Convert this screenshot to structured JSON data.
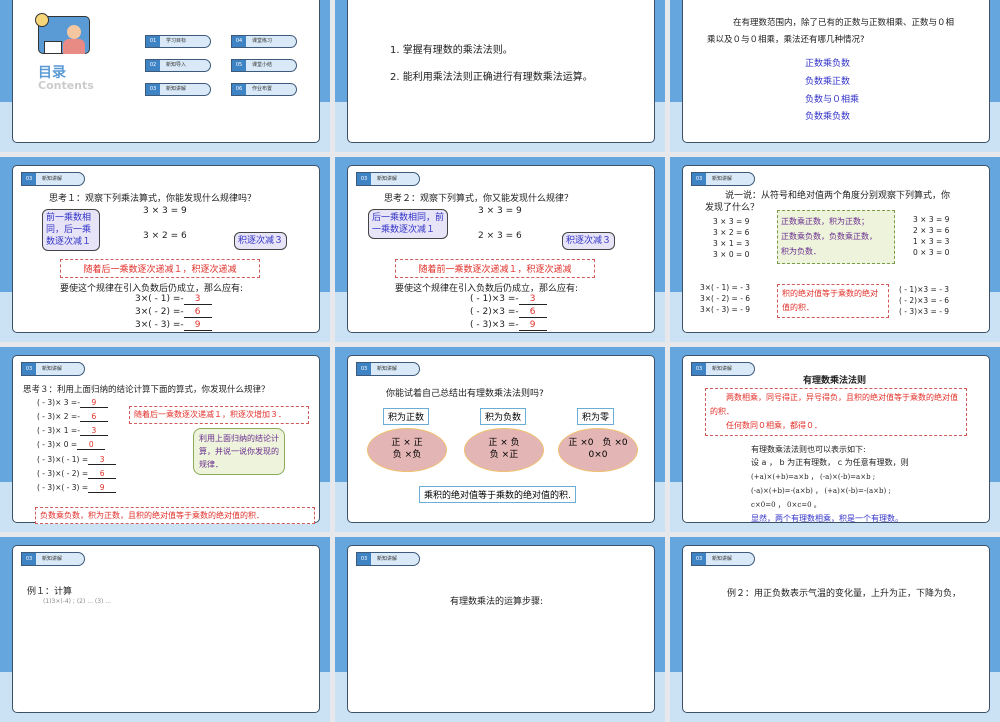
{
  "tag": {
    "num": "03",
    "label": "新知讲解"
  },
  "s1": {
    "title": "目录",
    "subtitle": "Contents",
    "items": [
      {
        "num": "01",
        "label": "学习目标"
      },
      {
        "num": "02",
        "label": "新知导入"
      },
      {
        "num": "03",
        "label": "新知讲解"
      },
      {
        "num": "04",
        "label": "课堂练习"
      },
      {
        "num": "05",
        "label": "课堂小结"
      },
      {
        "num": "06",
        "label": "作业布置"
      }
    ]
  },
  "s2": {
    "lines": [
      "1. 掌握有理数的乘法法则。",
      "2. 能利用乘法法则正确进行有理数乘法运算。"
    ]
  },
  "s3": {
    "intro": "在有理数范围内，除了已有的正数与正数相乘、正数与０相",
    "intro2": "乘以及０与０相乘，乘法还有哪几种情况?",
    "items": [
      "正数乘负数",
      "负数乘正数",
      "负数与０相乘",
      "负数乘负数"
    ]
  },
  "s4": {
    "q": "思考１：观察下列乘法算式，你能发现什么规律吗？",
    "eq": [
      "3 × 3  =  9",
      "3 × 2  =  6"
    ],
    "bubble": "前一乘数相同，后一乘数逐次减１",
    "bubble2": "积逐次减３",
    "note": "随着后一乘数逐次递减１，积逐次递减",
    "cond": "要使这个规律在引入负数后仍成立，那么应有:",
    "rows": [
      {
        "e": "3×( - 1) =-",
        "a": "3"
      },
      {
        "e": "3×( - 2) =-",
        "a": "6"
      },
      {
        "e": "3×( - 3) =-",
        "a": "9"
      }
    ]
  },
  "s5": {
    "q": "思考２：观察下列算式，你又能发现什么规律？",
    "eq": [
      "3 × 3  =  9",
      "2 × 3  =  6"
    ],
    "bubble": "后一乘数相同，前一乘数逐次减１",
    "bubble2": "积逐次减３",
    "note": "随着前一乘数逐次递减１，积逐次递减",
    "cond": "要使这个规律在引入负数后仍成立，那么应有:",
    "rows": [
      {
        "e": "( - 1)×3 =-",
        "a": "3"
      },
      {
        "e": "( - 2)×3 =-",
        "a": "6"
      },
      {
        "e": "( - 3)×3 =-",
        "a": "9"
      }
    ]
  },
  "s6": {
    "q": "说一说：从符号和绝对值两个角度分别观察下列算式，你",
    "q2": "发现了什么？",
    "left": [
      "3 × 3  =  9",
      "3 × 2  =  6",
      "3 × 1  =  3",
      "3 × 0  =  0"
    ],
    "right": [
      "3 × 3  =  9",
      "2 × 3  =  6",
      "1 × 3  =  3",
      "0 × 3  =  0"
    ],
    "green": [
      "正数乘正数，积为正数；",
      "正数乘负数，负数乘正数，",
      "积为负数．"
    ],
    "left2": [
      "3×( - 1) = - 3",
      "3×( - 2) = - 6",
      "3×( - 3) = - 9"
    ],
    "right2": [
      "( - 1)×3 = - 3",
      "( - 2)×3 = - 6",
      "( - 3)×3 = - 9"
    ],
    "red": "积的绝对值等于乘数的绝对值的积．"
  },
  "s7": {
    "q": "思考３：利用上面归纳的结论计算下面的算式，你发现什么规律？",
    "rows": [
      {
        "e": "( - 3)× 3  =-",
        "a": "9"
      },
      {
        "e": "( - 3)× 2  =-",
        "a": "6"
      },
      {
        "e": "( - 3)× 1  =-",
        "a": "3"
      },
      {
        "e": "( - 3)× 0  =",
        "a": "0"
      },
      {
        "e": "( - 3)×( - 1) =",
        "a": "3"
      },
      {
        "e": "( - 3)×( - 2) =",
        "a": "6"
      },
      {
        "e": "( - 3)×( - 3) =",
        "a": "9"
      }
    ],
    "note": "随着后一乘数逐次递减１，积逐次增加３．",
    "bubble": "利用上面归纳的结论计算，并说一说你发现的规律．",
    "concl": "负数乘负数，积为正数，且积的绝对值等于乘数的绝对值的积．"
  },
  "s8": {
    "q": "你能试着自己总结出有理数乘法法则吗?",
    "labels": [
      "积为正数",
      "积为负数",
      "积为零"
    ],
    "ovals": [
      [
        "正 × 正",
        "负 ×负"
      ],
      [
        "正 × 负",
        "负 ×正"
      ],
      [
        "正 ×0　负 ×0",
        "0×0"
      ]
    ],
    "concl": "乘积的绝对值等于乘数的绝对值的积."
  },
  "s9": {
    "title": "有理数乘法法则",
    "rule1": "两数相乘，同号得正，异号得负，且积的绝对值等于乘数的绝对值的积．",
    "rule2": "任何数同０相乘，都得０．",
    "lines": [
      "有理数乘法法则也可以表示如下:",
      "设 a ， b 为正有理数， c 为任意有理数，则",
      "(+a)×(+b)=a×b ， (-a)×(-b)=a×b ;",
      "(-a)×(+b)=-(a×b) ， (+a)×(-b)=-(a×b) ;",
      "c×0=0 ， 0×c=0 。"
    ],
    "concl": "显然，两个有理数相乘，积是一个有理数。"
  },
  "s10": {
    "q": "例１：计算",
    "sub": "(1)3×(-4) ;  (2) ...  (3) ..."
  },
  "s11": {
    "q": "有理数乘法的运算步骤:"
  },
  "s12": {
    "q": "例２：用正负数表示气温的变化量，上升为正，下降为负，"
  }
}
